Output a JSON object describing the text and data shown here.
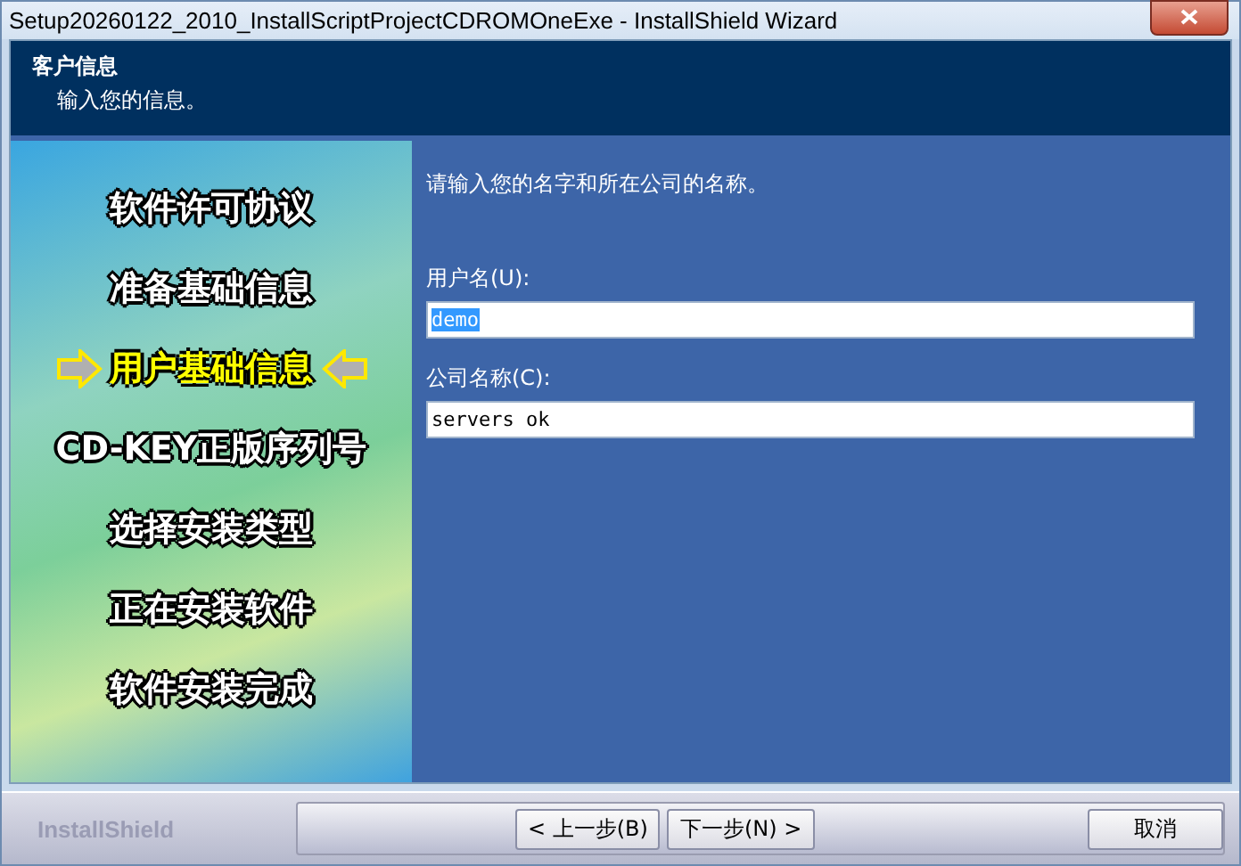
{
  "window": {
    "title": "Setup20260122_2010_InstallScriptProjectCDROMOneExe - InstallShield Wizard"
  },
  "header": {
    "title": "客户信息",
    "subtitle": "输入您的信息。"
  },
  "steps": [
    {
      "label": "软件许可协议",
      "selected": false
    },
    {
      "label": "准备基础信息",
      "selected": false
    },
    {
      "label": "用户基础信息",
      "selected": true
    },
    {
      "label": "CD-KEY正版序列号",
      "selected": false
    },
    {
      "label": "选择安装类型",
      "selected": false
    },
    {
      "label": "正在安装软件",
      "selected": false
    },
    {
      "label": "软件安装完成",
      "selected": false
    }
  ],
  "form": {
    "instruction": "请输入您的名字和所在公司的名称。",
    "fields": [
      {
        "label": "用户名(U):",
        "value": "demo",
        "selected": true
      },
      {
        "label": "公司名称(C):",
        "value": "servers ok",
        "selected": false
      }
    ]
  },
  "footer": {
    "brand": "InstallShield",
    "buttons": [
      {
        "label": "< 上一步(B)"
      },
      {
        "label": "下一步(N) >"
      }
    ],
    "cancel": "取消"
  }
}
